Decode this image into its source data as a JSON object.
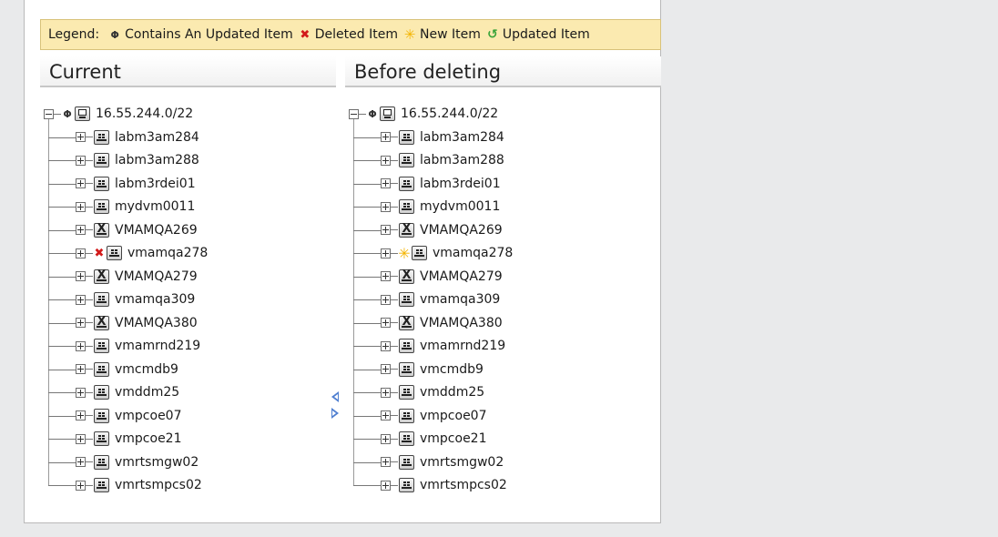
{
  "legend": {
    "label": "Legend:",
    "items": [
      {
        "icon": "contains-updated-icon",
        "glyph": "Φ",
        "text": "Contains An Updated Item",
        "color": "#333333"
      },
      {
        "icon": "deleted-icon",
        "glyph": "✖",
        "text": "Deleted Item",
        "color": "#d21a1a"
      },
      {
        "icon": "new-icon",
        "glyph": "✳",
        "text": "New Item",
        "color": "#f4b400"
      },
      {
        "icon": "updated-icon",
        "glyph": "↺",
        "text": "Updated Item",
        "color": "#3aa43a"
      }
    ]
  },
  "current": {
    "title": "Current",
    "root": {
      "label": "16.55.244.0/22",
      "marker": "contains-updated",
      "icon": "network-icon",
      "expanded": true
    },
    "children": [
      {
        "label": "labm3am284",
        "icon": "windows-host-icon",
        "marker": ""
      },
      {
        "label": "labm3am288",
        "icon": "windows-host-icon",
        "marker": ""
      },
      {
        "label": "labm3rdei01",
        "icon": "windows-host-icon",
        "marker": ""
      },
      {
        "label": "mydvm0011",
        "icon": "windows-host-icon",
        "marker": ""
      },
      {
        "label": "VMAMQA269",
        "icon": "vmware-host-icon",
        "marker": ""
      },
      {
        "label": "vmamqa278",
        "icon": "windows-host-icon",
        "marker": "deleted"
      },
      {
        "label": "VMAMQA279",
        "icon": "vmware-host-icon",
        "marker": ""
      },
      {
        "label": "vmamqa309",
        "icon": "windows-host-icon",
        "marker": ""
      },
      {
        "label": "VMAMQA380",
        "icon": "vmware-host-icon",
        "marker": ""
      },
      {
        "label": "vmamrnd219",
        "icon": "windows-host-icon",
        "marker": ""
      },
      {
        "label": "vmcmdb9",
        "icon": "windows-host-icon",
        "marker": ""
      },
      {
        "label": "vmddm25",
        "icon": "windows-host-icon",
        "marker": ""
      },
      {
        "label": "vmpcoe07",
        "icon": "windows-host-icon",
        "marker": ""
      },
      {
        "label": "vmpcoe21",
        "icon": "windows-host-icon",
        "marker": ""
      },
      {
        "label": "vmrtsmgw02",
        "icon": "windows-host-icon",
        "marker": ""
      },
      {
        "label": "vmrtsmpcs02",
        "icon": "windows-host-icon",
        "marker": ""
      }
    ]
  },
  "before": {
    "title": "Before deleting",
    "root": {
      "label": "16.55.244.0/22",
      "marker": "contains-updated",
      "icon": "network-icon",
      "expanded": true
    },
    "children": [
      {
        "label": "labm3am284",
        "icon": "windows-host-icon",
        "marker": ""
      },
      {
        "label": "labm3am288",
        "icon": "windows-host-icon",
        "marker": ""
      },
      {
        "label": "labm3rdei01",
        "icon": "windows-host-icon",
        "marker": ""
      },
      {
        "label": "mydvm0011",
        "icon": "windows-host-icon",
        "marker": ""
      },
      {
        "label": "VMAMQA269",
        "icon": "vmware-host-icon",
        "marker": ""
      },
      {
        "label": "vmamqa278",
        "icon": "windows-host-icon",
        "marker": "new"
      },
      {
        "label": "VMAMQA279",
        "icon": "vmware-host-icon",
        "marker": ""
      },
      {
        "label": "vmamqa309",
        "icon": "windows-host-icon",
        "marker": ""
      },
      {
        "label": "VMAMQA380",
        "icon": "vmware-host-icon",
        "marker": ""
      },
      {
        "label": "vmamrnd219",
        "icon": "windows-host-icon",
        "marker": ""
      },
      {
        "label": "vmcmdb9",
        "icon": "windows-host-icon",
        "marker": ""
      },
      {
        "label": "vmddm25",
        "icon": "windows-host-icon",
        "marker": ""
      },
      {
        "label": "vmpcoe07",
        "icon": "windows-host-icon",
        "marker": ""
      },
      {
        "label": "vmpcoe21",
        "icon": "windows-host-icon",
        "marker": ""
      },
      {
        "label": "vmrtsmgw02",
        "icon": "windows-host-icon",
        "marker": ""
      },
      {
        "label": "vmrtsmpcs02",
        "icon": "windows-host-icon",
        "marker": ""
      }
    ]
  },
  "splitter": {
    "left_icon": "arrow-left-icon",
    "right_icon": "arrow-right-icon"
  }
}
